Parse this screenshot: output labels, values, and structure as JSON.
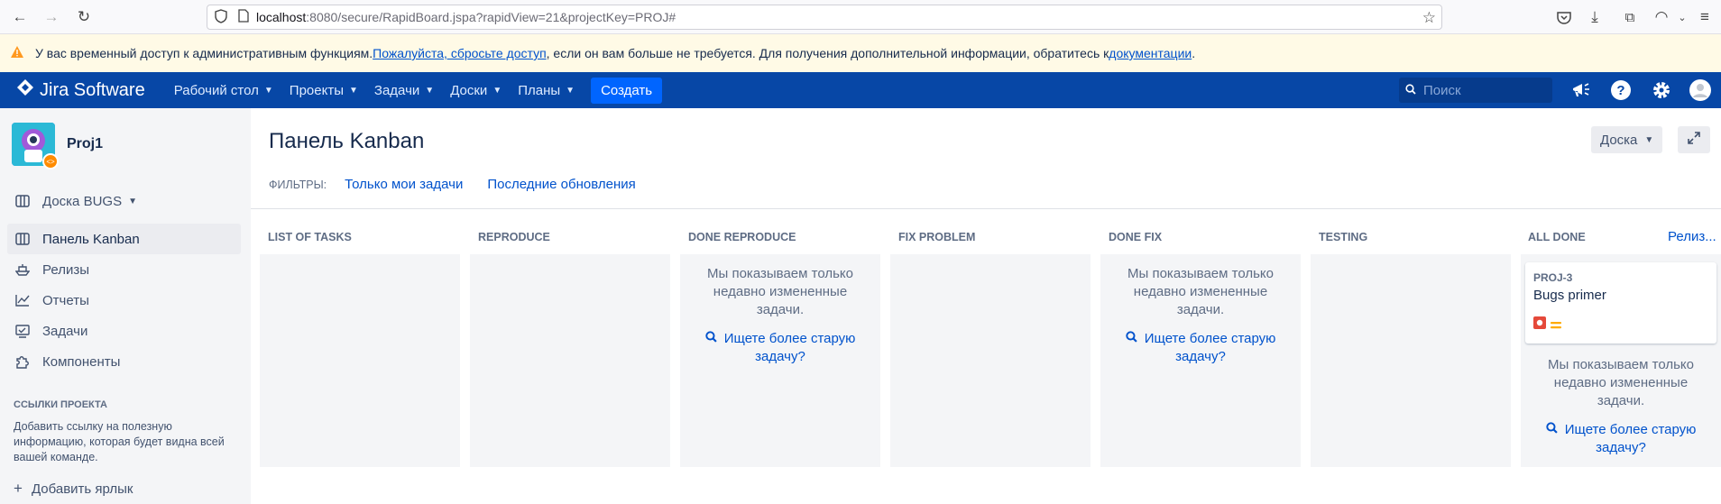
{
  "browser": {
    "url_host": "localhost",
    "url_rest": ":8080/secure/RapidBoard.jspa?rapidView=21&projectKey=PROJ#"
  },
  "banner": {
    "text_before": "У вас временный доступ к административным функциям. ",
    "link1": "Пожалуйста, сбросьте доступ ",
    "text_middle": ", если он вам больше не требуется. Для получения дополнительной информации, обратитесь к ",
    "link2": "документации ",
    "text_after": "."
  },
  "header": {
    "logo_text": "Jira Software",
    "nav": [
      "Рабочий стол",
      "Проекты",
      "Задачи",
      "Доски",
      "Планы"
    ],
    "create_label": "Создать",
    "search_placeholder": "Поиск"
  },
  "sidebar": {
    "project_name": "Proj1",
    "board_selector": "Доска BUGS",
    "items": [
      {
        "label": "Панель Kanban",
        "icon": "board-icon"
      },
      {
        "label": "Релизы",
        "icon": "ship-icon"
      },
      {
        "label": "Отчеты",
        "icon": "chart-icon"
      },
      {
        "label": "Задачи",
        "icon": "issues-icon"
      },
      {
        "label": "Компоненты",
        "icon": "puzzle-icon"
      }
    ],
    "section_title": "ССЫЛКИ ПРОЕКТА",
    "section_desc": "Добавить ссылку на полезную информацию, которая будет видна всей вашей команде.",
    "add_label": "Добавить ярлык"
  },
  "main": {
    "title": "Панель Kanban",
    "board_button": "Доска",
    "filters_label": "ФИЛЬТРЫ:",
    "filters": [
      "Только мои задачи",
      "Последние обновления"
    ],
    "release_link": "Релиз...",
    "columns": [
      {
        "name": "LIST OF TASKS"
      },
      {
        "name": "REPRODUCE"
      },
      {
        "name": "DONE REPRODUCE"
      },
      {
        "name": "FIX PROBLEM"
      },
      {
        "name": "DONE FIX"
      },
      {
        "name": "TESTING"
      },
      {
        "name": "ALL DONE"
      }
    ],
    "recent_msg": "Мы показываем только недавно измененные задачи.",
    "older_link": "Ищете более старую задачу?",
    "card": {
      "key": "PROJ-3",
      "summary": "Bugs primer"
    }
  },
  "colors": {
    "header": "#0747a6",
    "link": "#0052cc",
    "banner": "#fffae6"
  }
}
